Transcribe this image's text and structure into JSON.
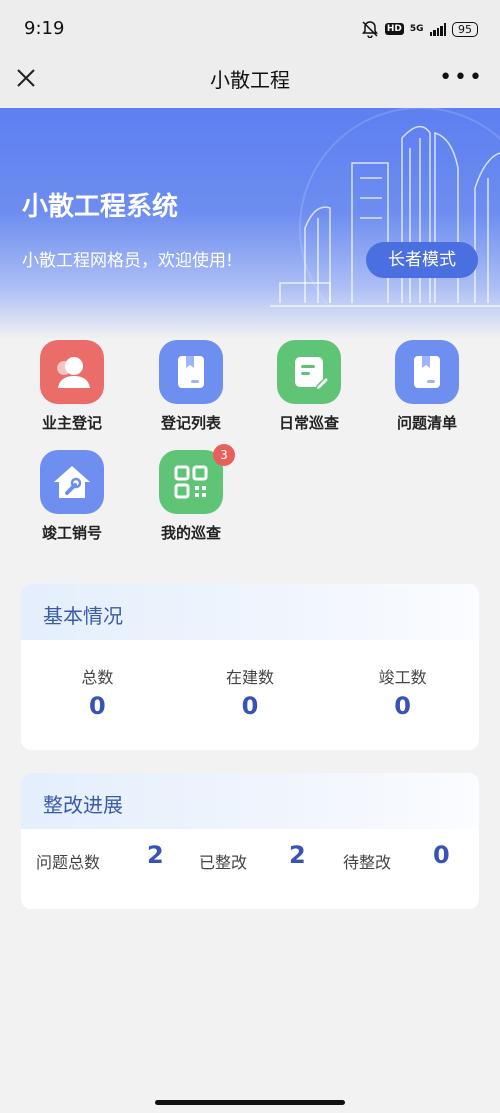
{
  "status": {
    "time": "9:19",
    "net": "5G",
    "hd": "HD",
    "battery": "95"
  },
  "nav": {
    "title": "小散工程"
  },
  "banner": {
    "title": "小散工程系统",
    "subtitle": "小散工程网格员，欢迎使用!",
    "elder_mode": "长者模式"
  },
  "menu": [
    {
      "label": "业主登记",
      "color": "#ea6d6a"
    },
    {
      "label": "登记列表",
      "color": "#6f8ff0"
    },
    {
      "label": "日常巡查",
      "color": "#5fc476"
    },
    {
      "label": "问题清单",
      "color": "#6f8ff0"
    },
    {
      "label": "竣工销号",
      "color": "#6f8ff0"
    },
    {
      "label": "我的巡查",
      "color": "#5fc476",
      "badge": "3"
    }
  ],
  "basic": {
    "title": "基本情况",
    "stats": [
      {
        "label": "总数",
        "value": "0"
      },
      {
        "label": "在建数",
        "value": "0"
      },
      {
        "label": "竣工数",
        "value": "0"
      }
    ]
  },
  "rectify": {
    "title": "整改进展",
    "total_label": "问题总数",
    "total_value": "2",
    "done_label": "已整改",
    "done_value": "2",
    "pending_label": "待整改",
    "pending_value": "0"
  }
}
